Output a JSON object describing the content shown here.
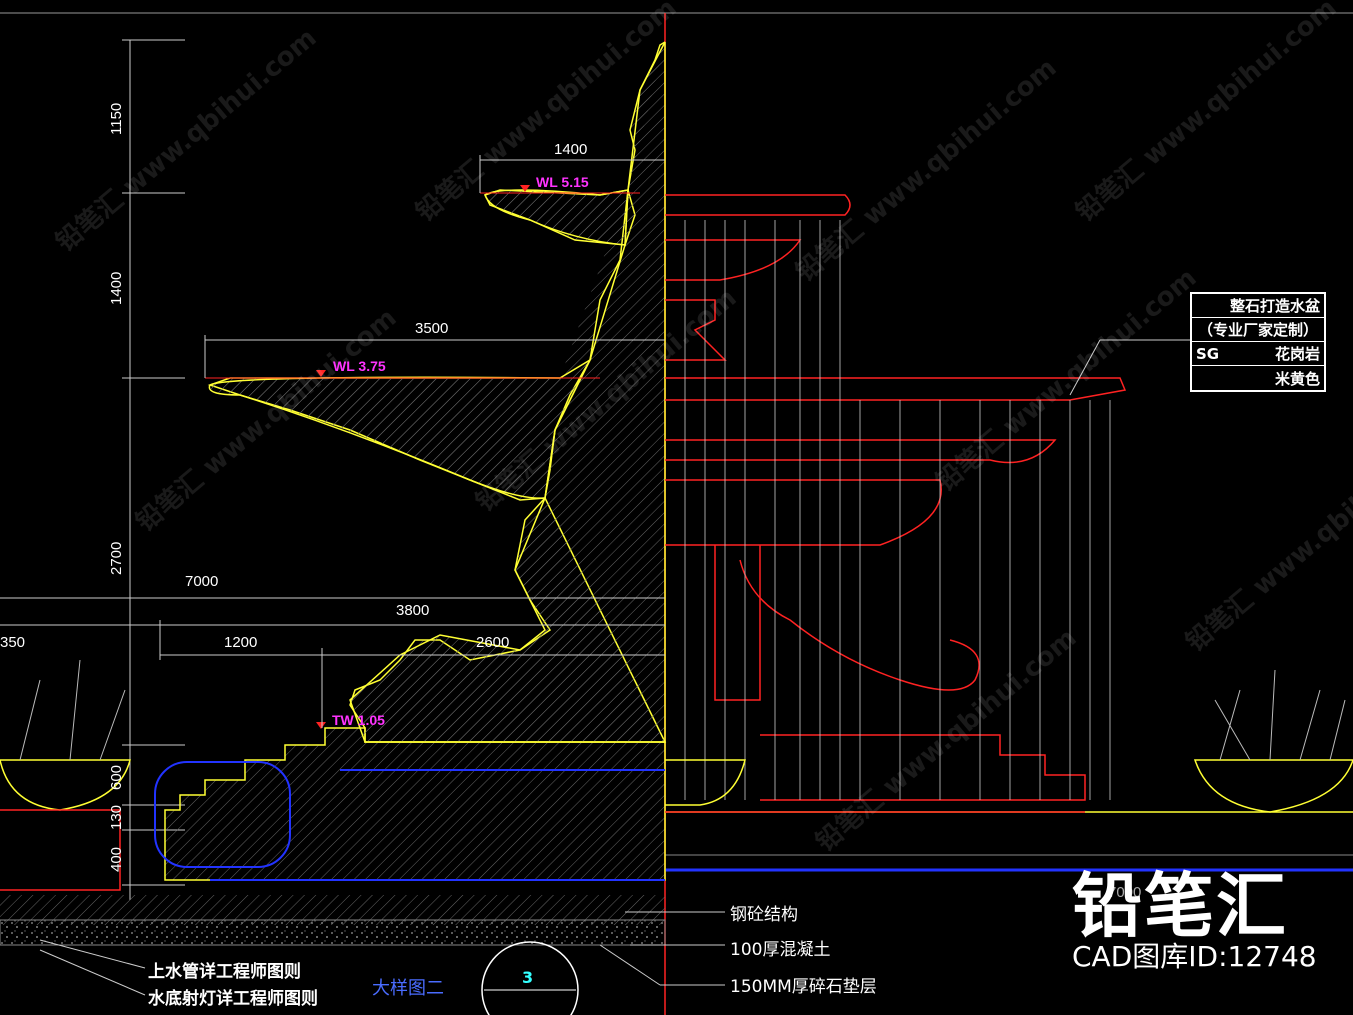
{
  "dimensions": {
    "vertical": [
      "1150",
      "1400",
      "2700",
      "600",
      "130",
      "400"
    ],
    "horizontal": {
      "d1400": "1400",
      "d3500": "3500",
      "d7000": "7000",
      "d3800": "3800",
      "d1200": "1200",
      "d2600": "2600",
      "d350": "350",
      "d7000_right": "7000"
    }
  },
  "water_levels": {
    "wl_top": "WL 5.15",
    "wl_mid": "WL 3.75",
    "tw": "TW 1.05"
  },
  "legend": {
    "row1": "整石打造水盆",
    "row2": "（专业厂家定制）",
    "row3_left": "SG",
    "row3_right": "花岗岩",
    "row4": "米黄色"
  },
  "notes": {
    "rc_structure": "钢砼结构",
    "concrete": "100厚混凝土",
    "gravel": "150MM厚碎石垫层",
    "supply_pipe": "上水管详工程师图则",
    "underwater_light": "水底射灯详工程师图则"
  },
  "detail_label": "大样图二",
  "detail_number": "3",
  "brand": {
    "name": "铅笔汇",
    "id_label": "CAD图库ID:12748"
  },
  "watermark": "铅笔汇 www.qbihui.com",
  "colors": {
    "yellow": "#ffff33",
    "red": "#ff2222",
    "blue": "#2233ff",
    "white": "#ffffff",
    "magenta": "#ff33ff",
    "cyan": "#33ffff"
  }
}
